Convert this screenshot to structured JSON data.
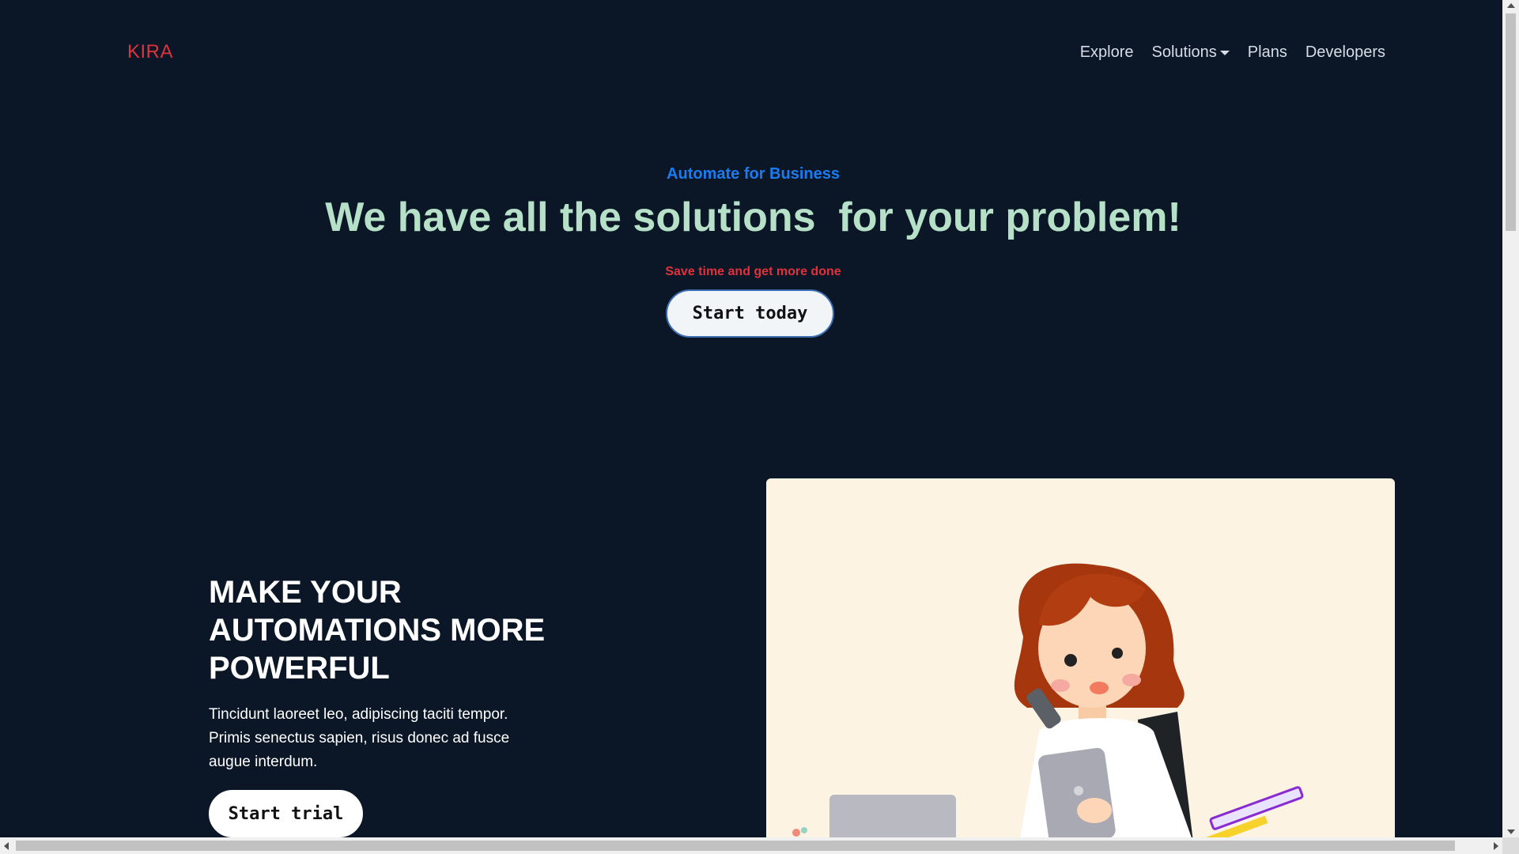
{
  "brand": "KIRA",
  "nav": {
    "explore": "Explore",
    "solutions": "Solutions",
    "plans": "Plans",
    "developers": "Developers"
  },
  "hero": {
    "eyebrow": "Automate for Business",
    "headline": "We have all the solutions  for your problem!",
    "tagline": "Save time and get more done",
    "cta": "Start today"
  },
  "feature": {
    "title": "MAKE YOUR AUTOMATIONS MORE POWERFUL",
    "body": "Tincidunt laoreet leo, adipiscing taciti tempor. Primis senectus sapien, risus donec ad fusce augue interdum.",
    "cta": "Start trial"
  },
  "illustration": {
    "subject": "woman-on-phone-with-tablet-illustration"
  },
  "colors": {
    "background": "#0b1727",
    "brand": "#e0323c",
    "eyebrow": "#1a7cf2",
    "headline": "#b7e0c9",
    "illustration_bg": "#fdf3e3"
  }
}
